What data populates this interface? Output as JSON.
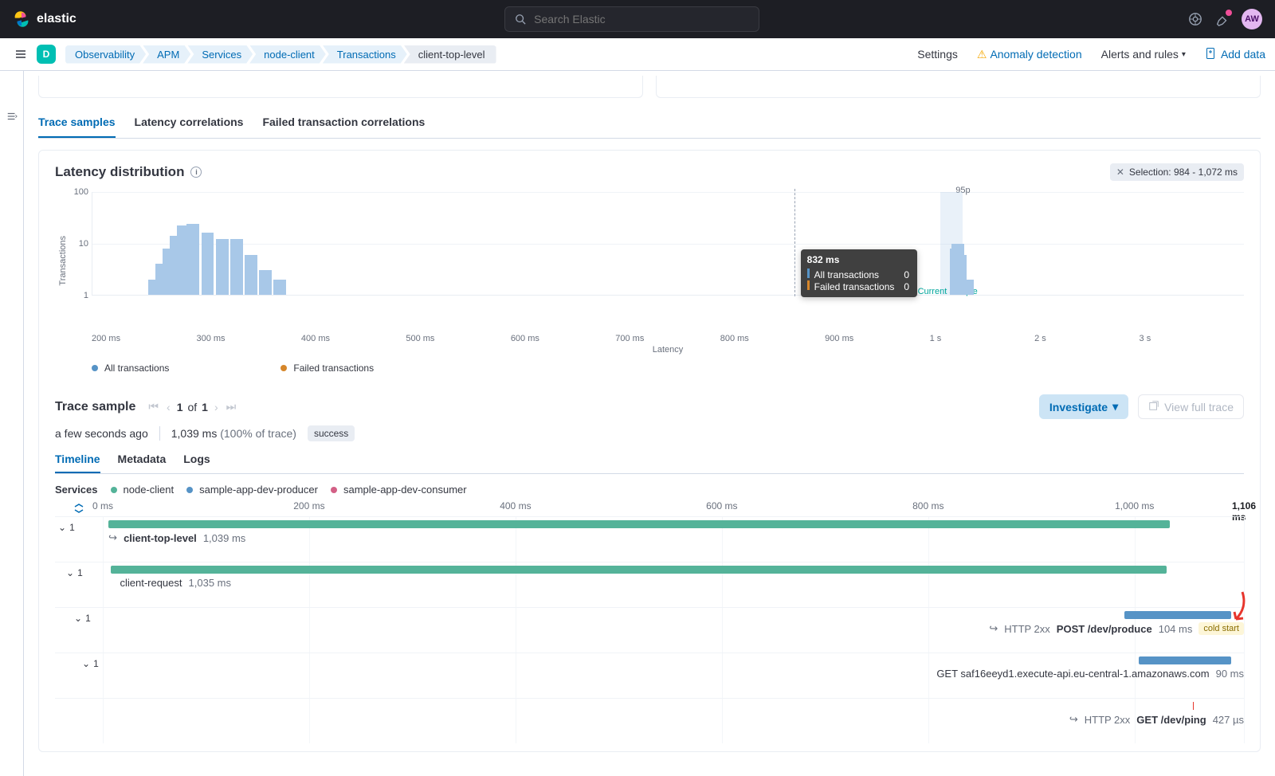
{
  "topbar": {
    "brand": "elastic",
    "search_placeholder": "Search Elastic",
    "avatar_initials": "AW"
  },
  "subheader": {
    "space": "D",
    "breadcrumbs": [
      "Observability",
      "APM",
      "Services",
      "node-client",
      "Transactions",
      "client-top-level"
    ],
    "settings": "Settings",
    "anomaly": "Anomaly detection",
    "alerts": "Alerts and rules",
    "add_data": "Add data"
  },
  "main_tabs": {
    "trace_samples": "Trace samples",
    "latency_corr": "Latency correlations",
    "failed_corr": "Failed transaction correlations"
  },
  "latency_panel": {
    "title": "Latency distribution",
    "selection_label": "Selection: 984 - 1,072 ms",
    "y_label": "Transactions",
    "y_ticks": [
      "100",
      "10",
      "1"
    ],
    "x_ticks": [
      "200 ms",
      "300 ms",
      "400 ms",
      "500 ms",
      "600 ms",
      "700 ms",
      "800 ms",
      "900 ms",
      "1 s",
      "2 s",
      "3 s"
    ],
    "x_label": "Latency",
    "p95_label": "95p",
    "current_sample": "Current sample",
    "tooltip": {
      "title": "832 ms",
      "row1_label": "All transactions",
      "row1_val": "0",
      "row2_label": "Failed transactions",
      "row2_val": "0"
    },
    "legend": {
      "all": "All transactions",
      "failed": "Failed transactions"
    }
  },
  "chart_data": {
    "type": "bar",
    "title": "Latency distribution",
    "xlabel": "Latency",
    "ylabel": "Transactions",
    "yscale": "log",
    "ylim": [
      1,
      100
    ],
    "x_ticks_ms": [
      200,
      300,
      400,
      500,
      600,
      700,
      800,
      900,
      1000,
      2000,
      3000
    ],
    "p95_ms": 1072,
    "selection_ms": [
      984,
      1072
    ],
    "hover_ms": 832,
    "series": [
      {
        "name": "All transactions",
        "color": "#5693c6",
        "bars": [
          {
            "x_ms": 130,
            "count": 2
          },
          {
            "x_ms": 145,
            "count": 4
          },
          {
            "x_ms": 160,
            "count": 8
          },
          {
            "x_ms": 175,
            "count": 14
          },
          {
            "x_ms": 190,
            "count": 22
          },
          {
            "x_ms": 205,
            "count": 24
          },
          {
            "x_ms": 220,
            "count": 16
          },
          {
            "x_ms": 235,
            "count": 12
          },
          {
            "x_ms": 250,
            "count": 12
          },
          {
            "x_ms": 265,
            "count": 6
          },
          {
            "x_ms": 280,
            "count": 3
          },
          {
            "x_ms": 295,
            "count": 2
          },
          {
            "x_ms": 335,
            "count": 1
          },
          {
            "x_ms": 380,
            "count": 1
          },
          {
            "x_ms": 420,
            "count": 1
          },
          {
            "x_ms": 920,
            "count": 1
          },
          {
            "x_ms": 1000,
            "count": 8
          },
          {
            "x_ms": 1020,
            "count": 10
          },
          {
            "x_ms": 1040,
            "count": 6
          },
          {
            "x_ms": 1090,
            "count": 2
          },
          {
            "x_ms": 1120,
            "count": 2
          }
        ]
      },
      {
        "name": "Failed transactions",
        "color": "#d6862a",
        "bars": []
      }
    ]
  },
  "trace_sample": {
    "title": "Trace sample",
    "page_current": "1",
    "page_of": "of",
    "page_total": "1",
    "investigate": "Investigate",
    "view_full_trace": "View full trace",
    "age": "a few seconds ago",
    "duration": "1,039 ms",
    "duration_pct": "(100% of trace)",
    "status": "success"
  },
  "inner_tabs": {
    "timeline": "Timeline",
    "metadata": "Metadata",
    "logs": "Logs"
  },
  "services_legend": {
    "label": "Services",
    "a": "node-client",
    "b": "sample-app-dev-producer",
    "c": "sample-app-dev-consumer"
  },
  "waterfall": {
    "ticks": [
      "0 ms",
      "200 ms",
      "400 ms",
      "600 ms",
      "800 ms",
      "1,000 ms",
      "1,106 ms"
    ],
    "total_ms": 1106,
    "rows": [
      {
        "children": "1",
        "name": "client-top-level",
        "dur": "1,039 ms"
      },
      {
        "children": "1",
        "name": "client-request",
        "dur": "1,035 ms"
      },
      {
        "children": "1",
        "http": "HTTP 2xx",
        "name": "POST /dev/produce",
        "dur": "104 ms",
        "badge": "cold start"
      },
      {
        "children": "1",
        "name": "GET saf16eeyd1.execute-api.eu-central-1.amazonaws.com",
        "dur": "90 ms"
      },
      {
        "http": "HTTP 2xx",
        "name": "GET /dev/ping",
        "dur": "427 µs"
      }
    ]
  },
  "colors": {
    "green": "#54b399",
    "blue": "#5693c6",
    "pink": "#d36086",
    "orange": "#d6862a",
    "lightblue": "#a8c8e8"
  }
}
